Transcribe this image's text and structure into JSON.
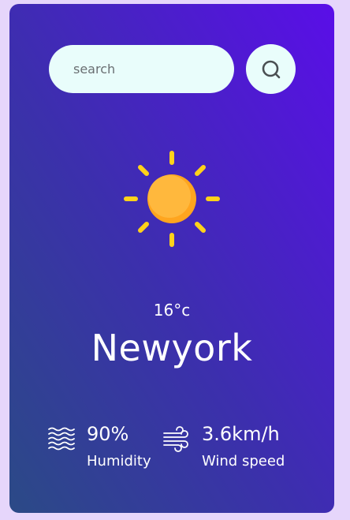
{
  "search": {
    "placeholder": "search",
    "value": "",
    "button_icon": "search-icon"
  },
  "weather": {
    "icon": "sun-icon",
    "temperature": "16°c",
    "city": "Newyork"
  },
  "stats": {
    "humidity": {
      "icon": "humidity-waves-icon",
      "value": "90%",
      "label": "Humidity"
    },
    "wind": {
      "icon": "wind-icon",
      "value": "3.6km/h",
      "label": "Wind speed"
    }
  },
  "colors": {
    "page_background": "#e6d6fb",
    "card_gradient_start": "#2b4a86",
    "card_gradient_end": "#5a0ee8",
    "input_background": "#e9fdfb",
    "sun_core": "#ffad33",
    "sun_rays": "#ffd21a"
  }
}
